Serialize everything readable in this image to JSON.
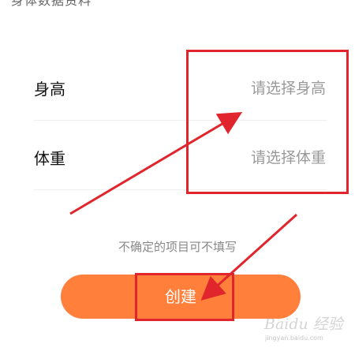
{
  "header": {
    "partial_text": "身体数据资料"
  },
  "form": {
    "height_label": "身高",
    "height_placeholder": "请选择身高",
    "weight_label": "体重",
    "weight_placeholder": "请选择体重"
  },
  "hint": "不确定的项目可不填写",
  "create_button": "创建",
  "watermark": {
    "brand": "Baidu 经验",
    "url": "jingyan.baidu.com"
  },
  "colors": {
    "accent": "#ff7f3b",
    "annotation": "#e0262c"
  }
}
